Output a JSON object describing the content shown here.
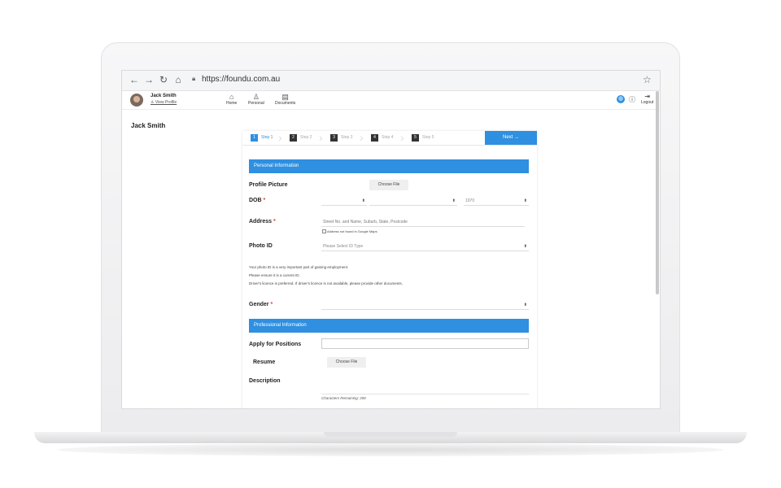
{
  "browser": {
    "url": "https://foundu.com.au",
    "nav_icons": [
      "back-arrow-icon",
      "forward-arrow-icon",
      "reload-icon",
      "home-icon"
    ],
    "star_icon": "bookmark-star-icon"
  },
  "header": {
    "user_name": "Jack Smith",
    "view_profile": "View Profile",
    "nav": [
      {
        "label": "Home",
        "icon": "home-icon"
      },
      {
        "label": "Personal",
        "icon": "person-icon"
      },
      {
        "label": "Documents",
        "icon": "document-icon"
      }
    ],
    "logout": "Logout"
  },
  "page_title": "Jack Smith",
  "steps": [
    {
      "num": "1",
      "label": "Step 1",
      "active": true
    },
    {
      "num": "2",
      "label": "Step 2"
    },
    {
      "num": "3",
      "label": "Step 3"
    },
    {
      "num": "4",
      "label": "Step 4"
    },
    {
      "num": "5",
      "label": "Step 5"
    }
  ],
  "next_button": "Next →",
  "personal": {
    "section_title": "Personal Information",
    "profile_picture_label": "Profile Picture",
    "choose_file": "Choose File",
    "dob_label": "DOB",
    "dob_year": "1970",
    "address_label": "Address",
    "address_placeholder": "Street No. and Name, Suburb, State, Postcode",
    "address_not_found": "Address not found in Google Maps",
    "photo_id_label": "Photo ID",
    "photo_id_placeholder": "Please Select ID Type",
    "info_lines": [
      "Your photo ID is a very important part of gaining employment.",
      "Please ensure it is a current ID.",
      "Driver's licence is preferred. If driver's licence is not available, please provide other documents."
    ],
    "gender_label": "Gender"
  },
  "professional": {
    "section_title": "Professional Information",
    "apply_label": "Apply for Positions",
    "resume_label": "Resume",
    "choose_file": "Choose File",
    "description_label": "Description",
    "chars_remaining": "Characters Remaining: 200"
  },
  "colors": {
    "accent": "#2f8fe0",
    "required": "#e23b3b"
  }
}
